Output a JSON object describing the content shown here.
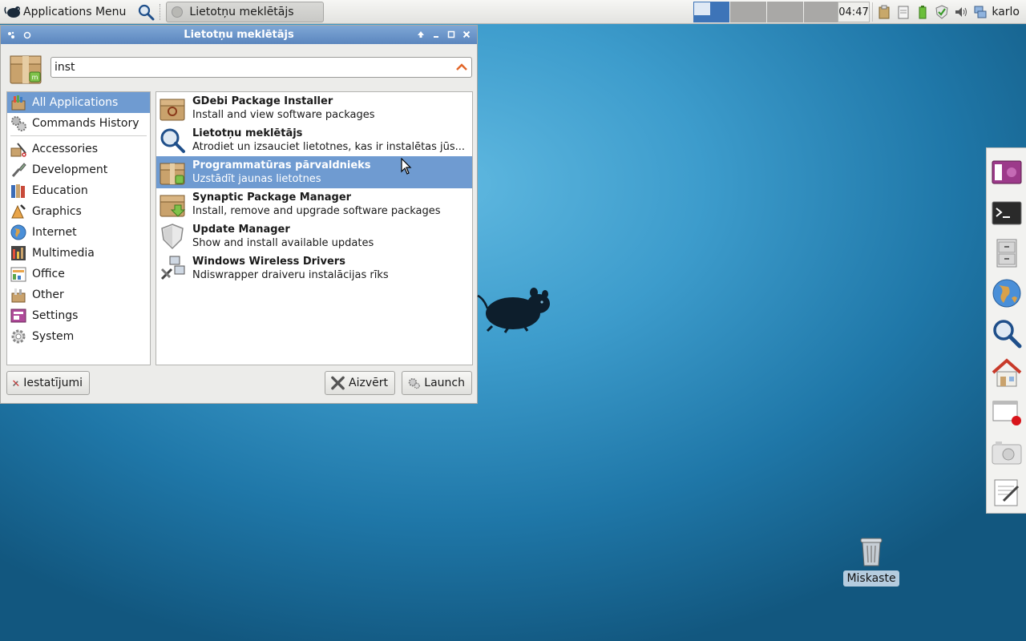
{
  "panel": {
    "apps_menu_label": "Applications Menu",
    "task_title": "Lietotņu meklētājs",
    "clock": "04:47",
    "username": "karlo"
  },
  "window": {
    "title": "Lietotņu meklētājs",
    "search_value": "inst"
  },
  "categories": [
    {
      "label": "All Applications",
      "icon": "all-applications-icon",
      "selected": true
    },
    {
      "label": "Commands History",
      "icon": "gears-icon"
    },
    {
      "label": "Accessories",
      "icon": "accessories-icon"
    },
    {
      "label": "Development",
      "icon": "development-icon"
    },
    {
      "label": "Education",
      "icon": "education-icon"
    },
    {
      "label": "Graphics",
      "icon": "graphics-icon"
    },
    {
      "label": "Internet",
      "icon": "globe-icon"
    },
    {
      "label": "Multimedia",
      "icon": "multimedia-icon"
    },
    {
      "label": "Office",
      "icon": "office-icon"
    },
    {
      "label": "Other",
      "icon": "other-icon"
    },
    {
      "label": "Settings",
      "icon": "settings-icon"
    },
    {
      "label": "System",
      "icon": "system-gear-icon"
    }
  ],
  "apps": [
    {
      "name": "GDebi Package Installer",
      "desc": "Install and view software packages",
      "icon": "package-box-icon"
    },
    {
      "name": "Lietotņu meklētājs",
      "desc": "Atrodiet un izsauciet lietotnes, kas ir instalētas jūs...",
      "icon": "magnifier-icon"
    },
    {
      "name": "Programmatūras pārvaldnieks",
      "desc": "Uzstādīt jaunas lietotnes",
      "icon": "package-box-icon",
      "selected": true
    },
    {
      "name": "Synaptic Package Manager",
      "desc": "Install, remove and upgrade software packages",
      "icon": "package-download-icon"
    },
    {
      "name": "Update Manager",
      "desc": "Show and install available updates",
      "icon": "shield-icon"
    },
    {
      "name": "Windows Wireless Drivers",
      "desc": "Ndiswrapper draiveru instalācijas rīks",
      "icon": "network-tools-icon"
    }
  ],
  "buttons": {
    "settings": "Iestatījumi",
    "close": "Aizvērt",
    "launch": "Launch"
  },
  "desktop": {
    "trash_label": "Miskaste"
  },
  "colors": {
    "selection": "#6f9bd1",
    "titlebar": "#6a94c8",
    "workspace_active": "#3d74b8"
  }
}
